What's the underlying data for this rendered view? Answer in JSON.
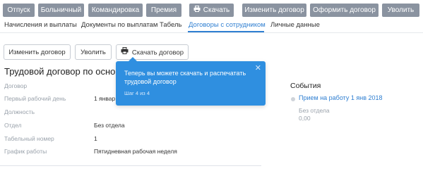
{
  "toolbar": {
    "buttons": [
      {
        "label": "Отпуск"
      },
      {
        "label": "Больничный"
      },
      {
        "label": "Командировка"
      },
      {
        "label": "Премия"
      },
      {
        "label": "Скачать",
        "icon": "printer-icon"
      },
      {
        "label": "Изменить договор"
      },
      {
        "label": "Оформить договор"
      },
      {
        "label": "Уволить"
      }
    ]
  },
  "tabs": [
    {
      "label": "Начисления и выплаты"
    },
    {
      "label": "Документы по выплатам"
    },
    {
      "label": "Табель"
    },
    {
      "label": "Договоры с сотрудником",
      "active": true
    },
    {
      "label": "Личные данные"
    }
  ],
  "actions": {
    "change_contract": "Изменить договор",
    "dismiss": "Уволить",
    "download_contract": "Скачать договор"
  },
  "contract": {
    "title": "Трудовой договор по осно",
    "fields": [
      {
        "label": "Договор",
        "value": ""
      },
      {
        "label": "Первый рабочий день",
        "value": "1 январ"
      },
      {
        "label": "Должность",
        "value": ""
      },
      {
        "label": "Отдел",
        "value": "Без отдела"
      },
      {
        "label": "Табельный номер",
        "value": "1"
      },
      {
        "label": "График работы",
        "value": "Пятидневная рабочая неделя"
      }
    ]
  },
  "events": {
    "title": "События",
    "items": [
      {
        "link": "Прием на работу 1 янв 2018",
        "department": "Без отдела",
        "amount": "0,00"
      }
    ]
  },
  "tooltip": {
    "text": "Теперь вы можете скачать и распечатать трудовой договор",
    "step": "Шаг 4 из 4",
    "close": "✕"
  },
  "colors": {
    "accent": "#2f7fd1",
    "tooltip_bg": "#2f8fe0",
    "toolbar_button": "#8a93a0"
  }
}
